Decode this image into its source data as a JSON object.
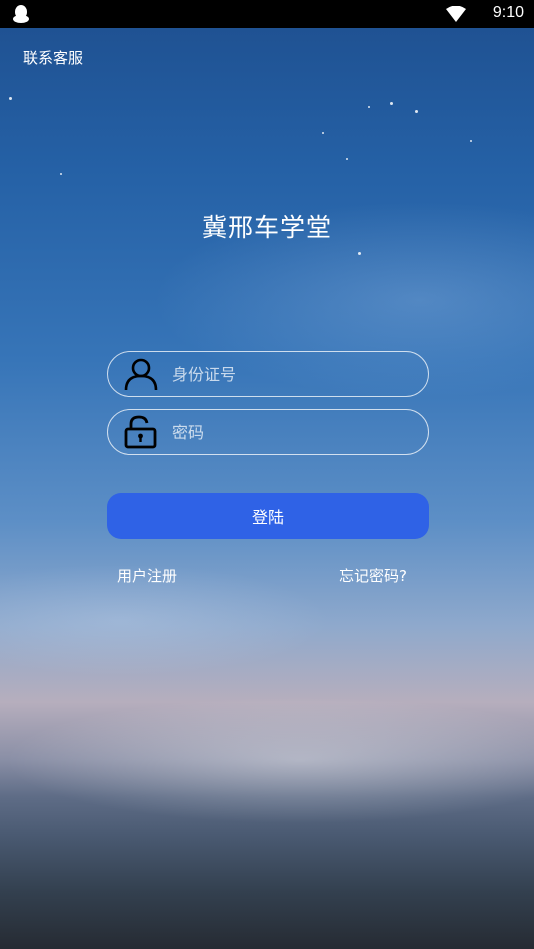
{
  "status_bar": {
    "time": "9:10",
    "icons": [
      "qq-penguin-icon",
      "wifi-icon"
    ]
  },
  "header": {
    "contact_label": "联系客服"
  },
  "app": {
    "title": "冀邢车学堂"
  },
  "form": {
    "id_placeholder": "身份证号",
    "id_icon": "user-icon",
    "password_placeholder": "密码",
    "password_icon": "unlock-icon",
    "login_label": "登陆",
    "register_label": "用户注册",
    "forgot_label": "忘记密码?"
  },
  "colors": {
    "accent_button": "#2f62e6",
    "status_bar": "#000000",
    "text": "#ffffff"
  }
}
